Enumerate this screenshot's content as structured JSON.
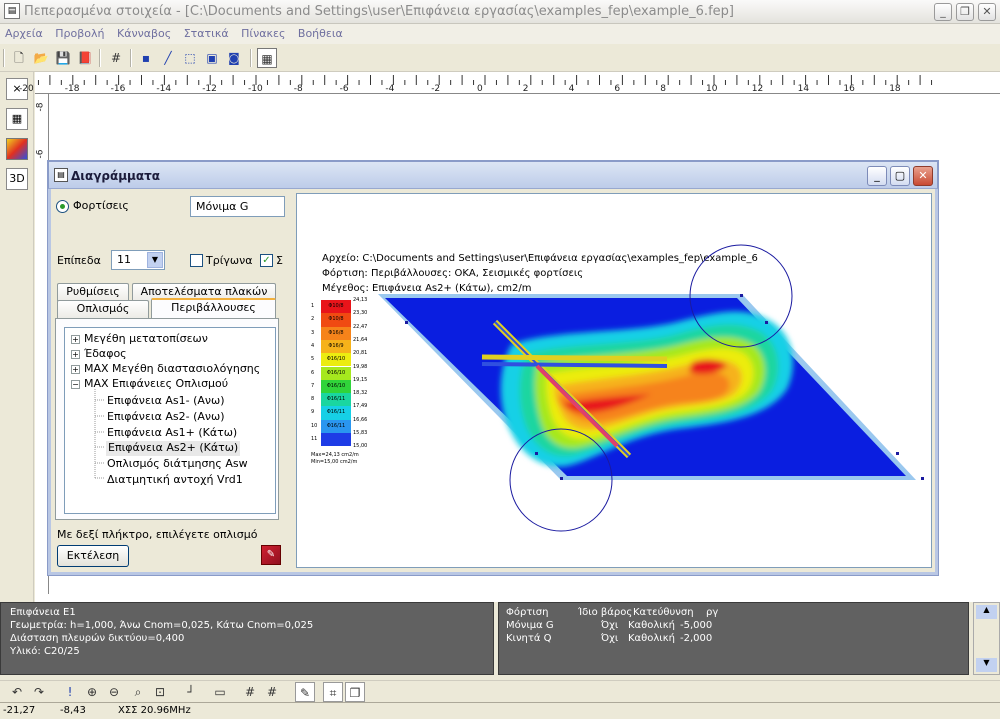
{
  "app": {
    "title": "Πεπερασμένα στοιχεία - [C:\\Documents and Settings\\user\\Επιφάνεια εργασίας\\examples_fep\\example_6.fep]",
    "menu": [
      "Αρχεία",
      "Προβολή",
      "Κάνναβος",
      "Στατικά",
      "Πίνακες",
      "Βοήθεια"
    ]
  },
  "ruler": {
    "h_ticks": [
      "-20",
      "-18",
      "-16",
      "-14",
      "-12",
      "-10",
      "-8",
      "-6",
      "-4",
      "-2",
      "0",
      "2",
      "4",
      "6",
      "8",
      "10",
      "12",
      "14",
      "16",
      "18"
    ],
    "v_ticks": [
      "-8",
      "-6"
    ]
  },
  "dialog": {
    "title": "Διαγράμματα",
    "loads_label": "Φορτίσεις",
    "load_value": "Μόνιμα G",
    "levels_label": "Επίπεδα",
    "levels_value": "11",
    "triangles_label": "Τρίγωνα",
    "sigma_label": "Σ",
    "tabs_row1": [
      "Ρυθμίσεις",
      "Αποτελέσματα πλακών"
    ],
    "tabs_row2": [
      "Οπλισμός",
      "Περιβάλλουσες"
    ],
    "tree": [
      {
        "label": "Μεγέθη μετατοπίσεων",
        "type": "collapsed"
      },
      {
        "label": "Έδαφος",
        "type": "collapsed"
      },
      {
        "label": "MAX Μεγέθη διαστασιολόγησης",
        "type": "collapsed"
      },
      {
        "label": "MAX Επιφάνειες Οπλισμού",
        "type": "expanded"
      },
      {
        "label": "Επιφάνεια As1- (Ανω)",
        "type": "child"
      },
      {
        "label": "Επιφάνεια As2- (Ανω)",
        "type": "child"
      },
      {
        "label": "Επιφάνεια As1+ (Κάτω)",
        "type": "child"
      },
      {
        "label": "Επιφάνεια As2+ (Κάτω)",
        "type": "child-selected"
      },
      {
        "label": "Οπλισμός διάτμησης Asw",
        "type": "child"
      },
      {
        "label": "Διατμητική αντοχή Vrd1",
        "type": "child"
      }
    ],
    "hint": "Με δεξί πλήκτρο, επιλέγετε οπλισμό",
    "run_button": "Εκτέλεση",
    "diagram": {
      "file_line": "Αρχείο: C:\\Documents and Settings\\user\\Επιφάνεια εργασίας\\examples_fep\\example_6",
      "load_line": "Φόρτιση: Περιβάλλουσες: ΟΚΑ, Σεισμικές φορτίσεις",
      "size_line": "Μέγεθος: Επιφάνεια As2+ (Κάτω), cm2/m",
      "legend": [
        {
          "n": "1",
          "bar": "Φ10/8",
          "value": "24,13",
          "color": "#e8141a"
        },
        {
          "n": "2",
          "bar": "Φ10/8",
          "value": "23,30",
          "color": "#f04a12"
        },
        {
          "n": "3",
          "bar": "Φ16/8",
          "value": "22,47",
          "color": "#f6831a"
        },
        {
          "n": "4",
          "bar": "Φ16/9",
          "value": "21,64",
          "color": "#f6b21a"
        },
        {
          "n": "5",
          "bar": "Φ16/10",
          "value": "20,81",
          "color": "#ecec10"
        },
        {
          "n": "6",
          "bar": "Φ16/10",
          "value": "19,98",
          "color": "#a6e81e"
        },
        {
          "n": "7",
          "bar": "Φ16/10",
          "value": "19,15",
          "color": "#30d43a"
        },
        {
          "n": "8",
          "bar": "Φ16/11",
          "value": "18,32",
          "color": "#1ad6a0"
        },
        {
          "n": "9",
          "bar": "Φ16/11",
          "value": "17,49",
          "color": "#16d0e6"
        },
        {
          "n": "10",
          "bar": "Φ16/11",
          "value": "16,66",
          "color": "#2a96f0"
        },
        {
          "n": "11",
          "bar": "",
          "value": "15,83",
          "color": "#1e3ce6"
        }
      ],
      "legend_last": "15,00",
      "max_text": "Max=24,13 cm2/m",
      "min_text": "Min=15,00 cm2/m"
    }
  },
  "info_left": [
    "Επιφάνεια Ε1",
    "Γεωμετρία: h=1,000, Άνω Cnom=0,025, Κάτω Cnom=0,025",
    "Διάσταση πλευρών δικτύου=0,400",
    "Υλικό: C20/25"
  ],
  "info_right": {
    "headers": [
      "Φόρτιση",
      "Ίδιο βάρος",
      "Κατεύθυνση",
      "ργ"
    ],
    "rows": [
      [
        "Μόνιμα G",
        "Όχι",
        "Καθολική",
        "-5,000"
      ],
      [
        "Κινητά Q",
        "Όχι",
        "Καθολική",
        "-2,000"
      ]
    ]
  },
  "status": {
    "x": "-21,27",
    "y": "-8,43",
    "info": "ΧΣΣ 20.96MHz"
  },
  "colors": {
    "blue": "#0a1ee0",
    "light_blue": "#8fc0ec",
    "accent": "#f3b13d"
  }
}
